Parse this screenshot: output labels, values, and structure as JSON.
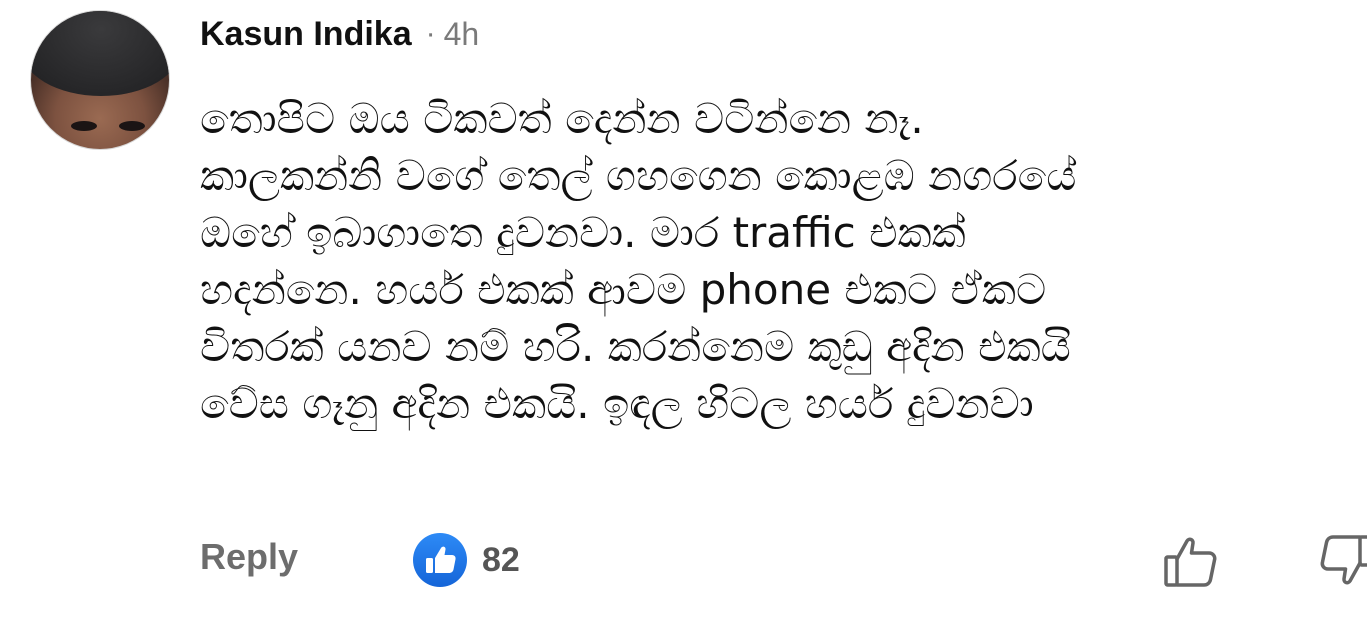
{
  "comment": {
    "author": "Kasun Indika",
    "separator": "·",
    "time": "4h",
    "lines": [
      "තොපිට ඔය ටිකවත් දෙන්න වටින්නෙ නෑ.",
      "කාලකන්නි වගේ තෙල් ගහගෙන කොළඹ නගරයේ",
      "ඔහේ ඉබාගාතෙ දුවනවා. මාර traffic එකක්",
      "හදන්නෙ.  හයර් එකක් ආවම phone එකට ඒකට",
      "විතරක් යනව නම් හරි.  කරන්නෙම කුඩු අදින එකයි",
      "වේස ගෑනු අදින එකයි. ඉඳල හිටල හයර් දුවනවා"
    ]
  },
  "actions": {
    "reply_label": "Reply",
    "like_count": "82"
  },
  "icons": {
    "avatar": "user-avatar",
    "like_badge": "like-badge-icon",
    "thumb_up": "thumbs-up-icon",
    "thumb_down": "thumbs-down-icon"
  },
  "colors": {
    "like_badge_blue": "#1a74e8",
    "muted_text": "#6d6d6d"
  }
}
